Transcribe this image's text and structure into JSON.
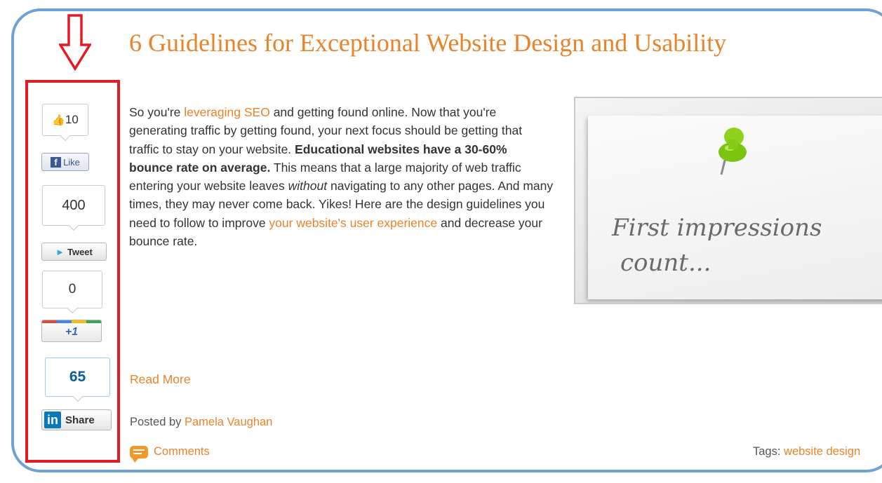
{
  "post": {
    "title": "6 Guidelines for Exceptional Website Design and Usability",
    "p1": "So you're ",
    "link_seo": "leveraging SEO",
    "p2": " and getting found online. Now that you're generating traffic by getting found, your next focus should be getting that traffic to stay on your website. ",
    "bold": "Educational websites have a 30-60% bounce rate on average.",
    "p3": " This means that a large majority of web traffic entering your website leaves ",
    "italic": "without",
    "p4": " navigating to any other pages. And many times, they may never come back. Yikes! Here are the design guidelines you need to follow to improve ",
    "link_ux": "your website's user experience",
    "p5": " and decrease your bounce rate.",
    "read_more": "Read More",
    "posted_by": "Posted by",
    "author": "Pamela Vaughan",
    "comments": "Comments",
    "tags_label": "Tags:",
    "tag": "website design"
  },
  "image": {
    "line1": "First impressions",
    "line2": "count..."
  },
  "share": {
    "facebook": {
      "count": "10",
      "label": "Like"
    },
    "twitter": {
      "count": "400",
      "label": "Tweet"
    },
    "google": {
      "count": "0",
      "label": "+1"
    },
    "linkedin": {
      "count": "65",
      "label": "Share",
      "logo": "in"
    }
  },
  "colors": {
    "accent": "#e8832a",
    "frame": "#6fa0d6",
    "highlight": "#e21b23"
  },
  "icons": [
    "down-arrow-icon",
    "thumbs-up-icon",
    "facebook-icon",
    "twitter-bird-icon",
    "linkedin-icon",
    "comment-bubble-icon",
    "pushpin-icon"
  ]
}
